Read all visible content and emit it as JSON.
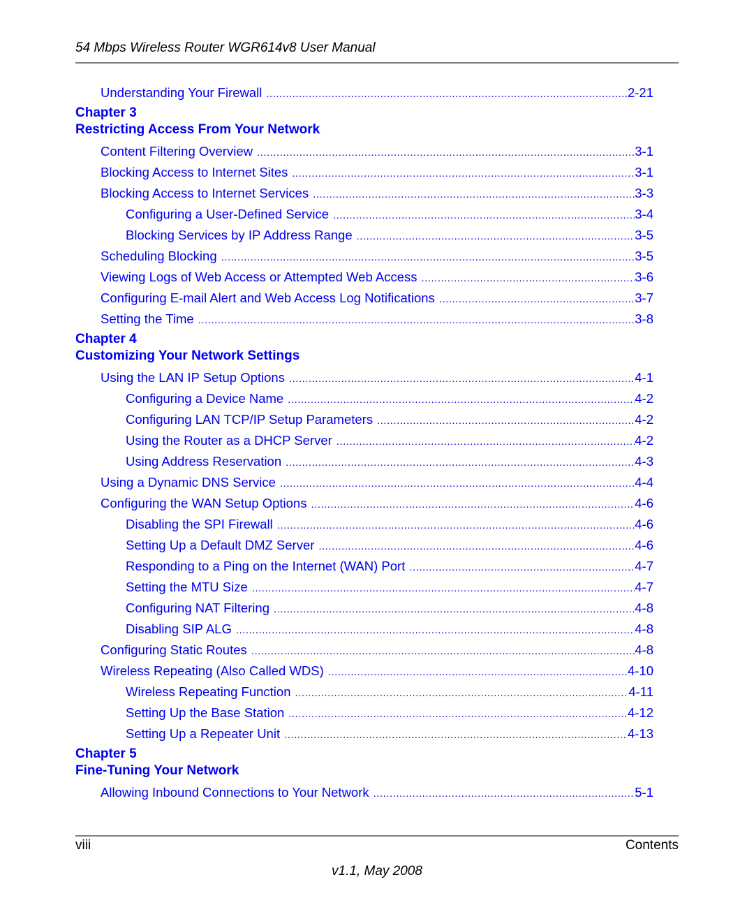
{
  "header": {
    "title": "54 Mbps Wireless Router WGR614v8 User Manual"
  },
  "colors": {
    "link": "#0000ee",
    "rule": "#808080",
    "text": "#000000"
  },
  "toc": {
    "continued_entries": [
      {
        "title": "Understanding Your Firewall",
        "page": "2-21",
        "level": 1
      }
    ],
    "chapters": [
      {
        "number_label": "Chapter 3",
        "title": "Restricting Access From Your Network",
        "entries": [
          {
            "title": "Content Filtering Overview",
            "page": "3-1",
            "level": 1
          },
          {
            "title": "Blocking Access to Internet Sites",
            "page": "3-1",
            "level": 1
          },
          {
            "title": "Blocking Access to Internet Services",
            "page": "3-3",
            "level": 1
          },
          {
            "title": "Configuring a User-Defined Service",
            "page": "3-4",
            "level": 2
          },
          {
            "title": "Blocking Services by IP Address Range",
            "page": "3-5",
            "level": 2
          },
          {
            "title": "Scheduling Blocking",
            "page": "3-5",
            "level": 1
          },
          {
            "title": "Viewing Logs of Web Access or Attempted Web Access",
            "page": "3-6",
            "level": 1
          },
          {
            "title": "Configuring E-mail Alert and Web Access Log Notifications",
            "page": "3-7",
            "level": 1
          },
          {
            "title": "Setting the Time",
            "page": "3-8",
            "level": 1
          }
        ]
      },
      {
        "number_label": "Chapter 4",
        "title": "Customizing Your Network Settings",
        "entries": [
          {
            "title": "Using the LAN IP Setup Options",
            "page": "4-1",
            "level": 1
          },
          {
            "title": "Configuring a Device Name",
            "page": "4-2",
            "level": 2
          },
          {
            "title": "Configuring LAN TCP/IP Setup Parameters",
            "page": "4-2",
            "level": 2
          },
          {
            "title": "Using the Router as a DHCP Server",
            "page": "4-2",
            "level": 2
          },
          {
            "title": "Using Address Reservation",
            "page": "4-3",
            "level": 2
          },
          {
            "title": "Using a Dynamic DNS Service",
            "page": "4-4",
            "level": 1
          },
          {
            "title": "Configuring the WAN Setup Options",
            "page": "4-6",
            "level": 1
          },
          {
            "title": "Disabling the SPI Firewall",
            "page": "4-6",
            "level": 2
          },
          {
            "title": "Setting Up a Default DMZ Server",
            "page": "4-6",
            "level": 2
          },
          {
            "title": "Responding to a Ping on the Internet (WAN) Port",
            "page": "4-7",
            "level": 2
          },
          {
            "title": "Setting the MTU Size",
            "page": "4-7",
            "level": 2
          },
          {
            "title": "Configuring NAT Filtering",
            "page": "4-8",
            "level": 2
          },
          {
            "title": "Disabling SIP ALG",
            "page": "4-8",
            "level": 2
          },
          {
            "title": "Configuring Static Routes",
            "page": "4-8",
            "level": 1
          },
          {
            "title": "Wireless Repeating (Also Called WDS)",
            "page": "4-10",
            "level": 1
          },
          {
            "title": "Wireless Repeating Function",
            "page": "4-11",
            "level": 2
          },
          {
            "title": "Setting Up the Base Station",
            "page": "4-12",
            "level": 2
          },
          {
            "title": "Setting Up a Repeater Unit",
            "page": "4-13",
            "level": 2
          }
        ]
      },
      {
        "number_label": "Chapter 5",
        "title": "Fine-Tuning Your Network",
        "entries": [
          {
            "title": "Allowing Inbound Connections to Your Network",
            "page": "5-1",
            "level": 1
          }
        ]
      }
    ]
  },
  "footer": {
    "page_number": "viii",
    "section": "Contents",
    "version": "v1.1, May 2008"
  }
}
